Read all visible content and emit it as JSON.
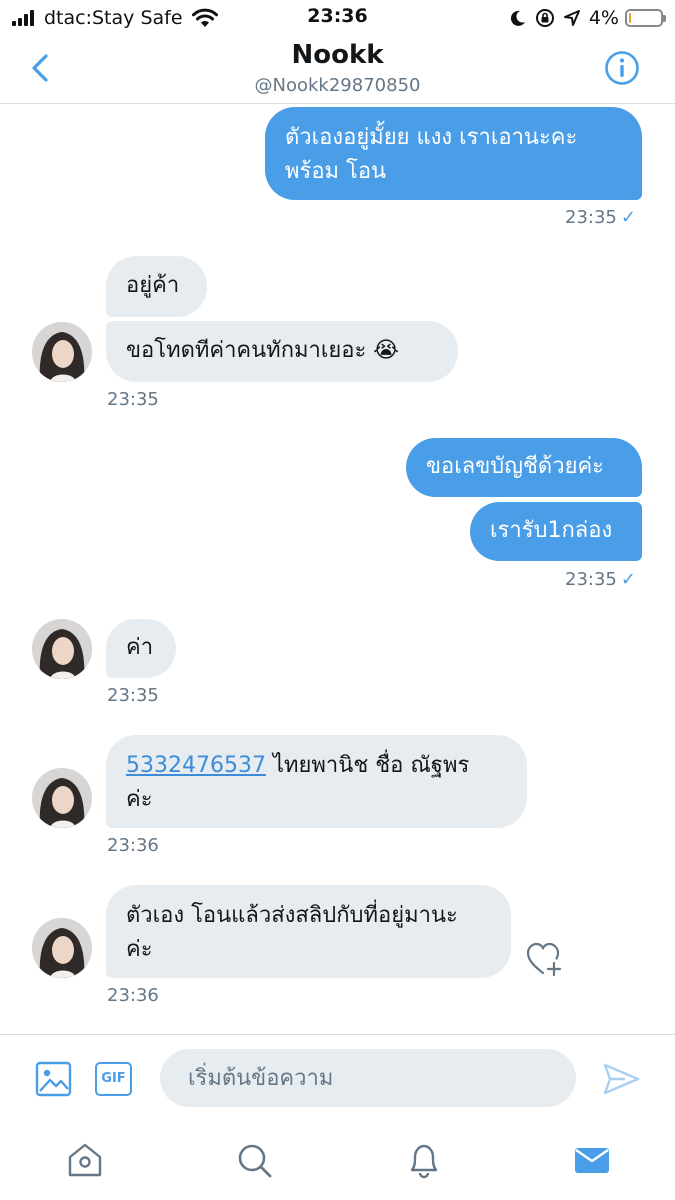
{
  "status_bar": {
    "carrier": "dtac:Stay Safe",
    "time": "23:36",
    "battery_percent": "4%",
    "battery_level": 0.04
  },
  "header": {
    "name": "Nookk",
    "handle": "@Nookk29870850"
  },
  "messages": [
    {
      "direction": "sent",
      "lines": [
        "ตัวเองอยู่มั้ยย แงง เราเอานะคะ",
        "พร้อม โอน"
      ]
    },
    {
      "direction": "sent_meta",
      "time": "23:35",
      "read": true
    },
    {
      "direction": "received",
      "lines": [
        "อยู่ค้า"
      ]
    },
    {
      "direction": "received",
      "lines": [
        "ขอโทดทีค่าคนทักมาเยอะ 😭"
      ]
    },
    {
      "direction": "received_meta",
      "time": "23:35"
    },
    {
      "direction": "sent",
      "lines": [
        "ขอเลขบัญชีด้วยค่ะ"
      ]
    },
    {
      "direction": "sent",
      "lines": [
        "เรารับ1กล่อง"
      ]
    },
    {
      "direction": "sent_meta",
      "time": "23:35",
      "read": true
    },
    {
      "direction": "received",
      "lines": [
        "ค่า"
      ]
    },
    {
      "direction": "received_meta",
      "time": "23:35"
    },
    {
      "direction": "received",
      "link": "5332476537",
      "rest": " ไทยพานิช ชื่อ ณัฐพร",
      "line2": "ค่ะ"
    },
    {
      "direction": "received_meta",
      "time": "23:36"
    },
    {
      "direction": "received",
      "lines": [
        "ตัวเอง โอนแล้วส่งสลิปกับที่อยู่มานะ",
        "ค่ะ"
      ]
    },
    {
      "direction": "received_meta",
      "time": "23:36"
    }
  ],
  "m": {
    "m1_l1": "ตัวเองอยู่มั้ยย แงง เราเอานะคะ",
    "m1_l2": "พร้อม โอน",
    "t1": "23:35",
    "m2": "อยู่ค้า",
    "m3": "ขอโทดทีค่าคนทักมาเยอะ 😭",
    "t2": "23:35",
    "m4": "ขอเลขบัญชีด้วยค่ะ",
    "m5": "เรารับ1กล่อง",
    "t3": "23:35",
    "m6": "ค่า",
    "t4": "23:35",
    "m7_link": "5332476537",
    "m7_rest": " ไทยพานิช ชื่อ ณัฐพร",
    "m7_l2": "ค่ะ",
    "t5": "23:36",
    "m8_l1": "ตัวเอง โอนแล้วส่งสลิปกับที่อยู่มานะ",
    "m8_l2": "ค่ะ",
    "t6": "23:36",
    "check": "✓"
  },
  "composer": {
    "placeholder": "เริ่มต้นข้อความ",
    "gif_label": "GIF"
  },
  "icons": {
    "back": "chevron-left-icon",
    "info": "info-icon",
    "image": "image-icon",
    "gif": "gif-icon",
    "send": "send-icon",
    "like": "heart-plus-icon",
    "tabs": [
      "home-icon",
      "search-icon",
      "bell-icon",
      "mail-icon"
    ]
  },
  "colors": {
    "accent": "#4a9de7",
    "received_bubble": "#e6ecf0",
    "secondary_text": "#657786"
  }
}
